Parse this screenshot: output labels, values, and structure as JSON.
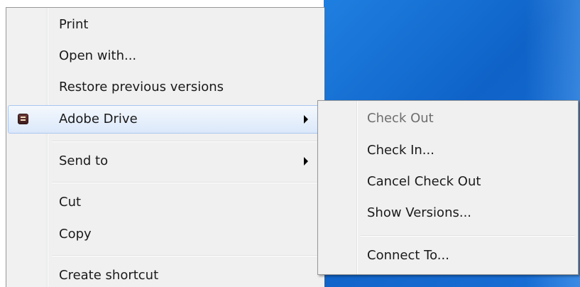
{
  "desktop": {
    "background_color": "#1368d0"
  },
  "context_menu": {
    "items": [
      {
        "label": "Print"
      },
      {
        "label": "Open with..."
      },
      {
        "label": "Restore previous versions"
      },
      {
        "label": "Adobe Drive",
        "icon": "adobe-drive-icon",
        "has_submenu": true,
        "highlighted": true
      },
      {
        "label": "Send to",
        "has_submenu": true
      },
      {
        "label": "Cut"
      },
      {
        "label": "Copy"
      },
      {
        "label": "Create shortcut"
      }
    ]
  },
  "submenu": {
    "items": [
      {
        "label": "Check Out",
        "disabled": true
      },
      {
        "label": "Check In..."
      },
      {
        "label": "Cancel Check Out"
      },
      {
        "label": "Show Versions..."
      },
      {
        "label": "Connect To..."
      }
    ]
  },
  "colors": {
    "menu_bg": "#f0f0f0",
    "highlight_border": "#a8c6ef",
    "disabled_text": "#6d6d6d"
  }
}
